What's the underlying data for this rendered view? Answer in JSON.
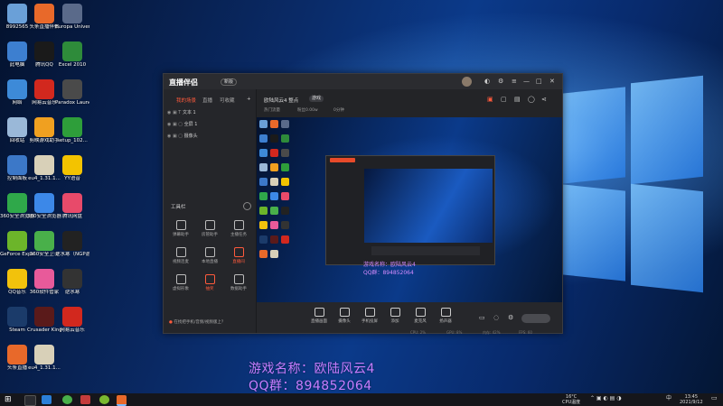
{
  "desktop": {
    "icons": [
      {
        "label": "8992565",
        "color": "#6aa0d8"
      },
      {
        "label": "头条直播伴侣",
        "color": "#e8692a"
      },
      {
        "label": "Europa Universal...",
        "color": "#5a6a8a"
      },
      {
        "label": "此电脑",
        "color": "#3d7fd0"
      },
      {
        "label": "腾讯QQ",
        "color": "#1a1a1a"
      },
      {
        "label": "Excel 2010",
        "color": "#2e8b3a"
      },
      {
        "label": "网络",
        "color": "#3d8ad8"
      },
      {
        "label": "网易云音乐",
        "color": "#d2281e"
      },
      {
        "label": "Paradox Launcher v2",
        "color": "#4a4a4a"
      },
      {
        "label": "回收站",
        "color": "#9ab8d8"
      },
      {
        "label": "剪映游戏助手",
        "color": "#f0a020"
      },
      {
        "label": "setup_102...",
        "color": "#2e9e3a"
      },
      {
        "label": "控制面板",
        "color": "#3c78c8"
      },
      {
        "label": "eu4_1.31.1...",
        "color": "#d8d0b8"
      },
      {
        "label": "YY语音",
        "color": "#f3c300"
      },
      {
        "label": "360安全浏览器",
        "color": "#2fa84a"
      },
      {
        "label": "360安全浏览器",
        "color": "#3c88e8"
      },
      {
        "label": "腾讯网盘",
        "color": "#e84a6a"
      },
      {
        "label": "GeForce Experience",
        "color": "#6cb52a"
      },
      {
        "label": "360安全卫士",
        "color": "#49b04a"
      },
      {
        "label": "逆水寒（NGP游戏）",
        "color": "#222222"
      },
      {
        "label": "QQ音乐",
        "color": "#f2c20c"
      },
      {
        "label": "360软件管家",
        "color": "#e85a9a"
      },
      {
        "label": "逆水寒",
        "color": "#333333"
      },
      {
        "label": "Steam",
        "color": "#1b3b6a"
      },
      {
        "label": "Crusader Kings III",
        "color": "#5a1a1a"
      },
      {
        "label": "网易云音乐",
        "color": "#d2281e"
      },
      {
        "label": "头条直播",
        "color": "#e8692a"
      },
      {
        "label": "eu4_1.31.1...",
        "color": "#d8d0b8"
      }
    ]
  },
  "app": {
    "title": "直播伴侣",
    "badge": "新版",
    "window_controls": [
      "—",
      "□",
      "✕"
    ],
    "tabs": [
      "我的场景",
      "直播",
      "可收藏"
    ],
    "scenes": [
      "文本 1",
      "全屏 1",
      "摄像头"
    ],
    "tools_title": "工具栏",
    "tools": [
      {
        "label": "弹幕助手",
        "icon": "chat-icon"
      },
      {
        "label": "房管助手",
        "icon": "user-icon"
      },
      {
        "label": "主播任务",
        "icon": "task-icon"
      },
      {
        "label": "视频连麦",
        "icon": "video-icon"
      },
      {
        "label": "本地直播",
        "icon": "download-icon"
      },
      {
        "label": "直播间",
        "icon": "gift-icon"
      },
      {
        "label": "虚拟形象",
        "icon": "avatar-icon"
      },
      {
        "label": "抽奖",
        "icon": "gift-box-icon"
      },
      {
        "label": "数据助手",
        "icon": "doc-icon"
      }
    ],
    "notice": "在找把手机/音频/视频版上？",
    "room_title": "欧陆风云4 整点",
    "room_tag": "游戏",
    "stats": [
      "热门流量",
      "粉丝0.00w",
      "0分钟"
    ],
    "bottom_buttons": [
      {
        "label": "直播画面",
        "icon": "screen-icon"
      },
      {
        "label": "摄像头",
        "icon": "camera-icon"
      },
      {
        "label": "手机投屏",
        "icon": "phone-icon"
      },
      {
        "label": "添加",
        "icon": "add-icon"
      },
      {
        "label": "麦克风",
        "icon": "mic-icon"
      },
      {
        "label": "扬声器",
        "icon": "speaker-icon"
      }
    ],
    "status": [
      "CPU: 2%",
      "GPU: 8%",
      "内存: 42%",
      "FPS: 60"
    ],
    "preview_game_name": "游戏名称：欧陆风云4",
    "preview_qq": "QQ群：894852064"
  },
  "overlay": {
    "game_name": "游戏名称：欧陆风云4",
    "qq": "QQ群：894852064"
  },
  "taskbar": {
    "weather": "16°C",
    "cpu": "CPU温度",
    "time": "13:45",
    "date": "2021/9/12",
    "lang": "中"
  }
}
